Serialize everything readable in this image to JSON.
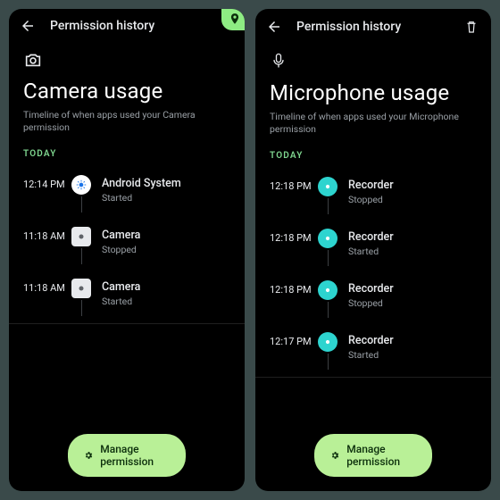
{
  "left": {
    "header_title": "Permission history",
    "status_pill_icon": "location",
    "icon": "camera",
    "page_title": "Camera usage",
    "subtitle": "Timeline of when apps used your Camera permission",
    "day_label": "TODAY",
    "entries": [
      {
        "time": "12:14 PM",
        "app": "Android System",
        "state": "Started",
        "icon": "system"
      },
      {
        "time": "11:18 AM",
        "app": "Camera",
        "state": "Stopped",
        "icon": "camera-app"
      },
      {
        "time": "11:18 AM",
        "app": "Camera",
        "state": "Started",
        "icon": "camera-app"
      }
    ],
    "manage_label": "Manage permission"
  },
  "right": {
    "header_title": "Permission history",
    "icon": "microphone",
    "page_title": "Microphone usage",
    "subtitle": "Timeline of when apps used your Microphone permission",
    "day_label": "TODAY",
    "entries": [
      {
        "time": "12:18 PM",
        "app": "Recorder",
        "state": "Stopped",
        "icon": "recorder"
      },
      {
        "time": "12:18 PM",
        "app": "Recorder",
        "state": "Started",
        "icon": "recorder"
      },
      {
        "time": "12:18 PM",
        "app": "Recorder",
        "state": "Stopped",
        "icon": "recorder"
      },
      {
        "time": "12:17 PM",
        "app": "Recorder",
        "state": "Started",
        "icon": "recorder"
      }
    ],
    "manage_label": "Manage permission"
  }
}
